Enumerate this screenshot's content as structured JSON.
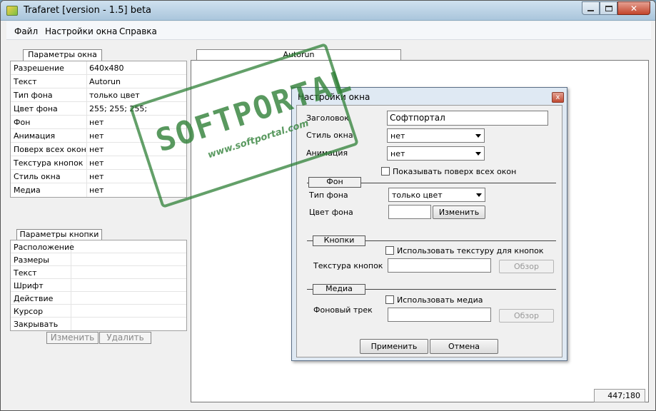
{
  "app": {
    "title": "Trafaret [version - 1.5] beta"
  },
  "menu": [
    "Файл",
    "Настройки окна",
    "Справка"
  ],
  "window_params": {
    "tab_label": "Параметры окна",
    "rows": [
      {
        "key": "Разрешение",
        "value": "640x480"
      },
      {
        "key": "Текст",
        "value": "Autorun"
      },
      {
        "key": "Тип фона",
        "value": "только цвет"
      },
      {
        "key": "Цвет фона",
        "value": "255; 255; 255;"
      },
      {
        "key": "Фон",
        "value": "нет"
      },
      {
        "key": "Анимация",
        "value": "нет"
      },
      {
        "key": "Поверх всех окон",
        "value": "нет"
      },
      {
        "key": "Текстура кнопок",
        "value": "нет"
      },
      {
        "key": "Стиль окна",
        "value": "нет"
      },
      {
        "key": "Медиа",
        "value": "нет"
      }
    ]
  },
  "button_params": {
    "tab_label": "Параметры кнопки",
    "rows": [
      "Расположение",
      "Размеры",
      "Текст",
      "Шрифт",
      "Действие",
      "Курсор",
      "Закрывать"
    ],
    "edit_label": "Изменить",
    "delete_label": "Удалить"
  },
  "canvas": {
    "tab_label": "Autorun",
    "coords": "447;180"
  },
  "dialog": {
    "title": "Настройки окна",
    "close_glyph": "x",
    "header_label": "Заголовок",
    "header_value": "Софтпортал",
    "window_style_label": "Стиль окна",
    "window_style_value": "нет",
    "animation_label": "Анимация",
    "animation_value": "нет",
    "topmost_label": "Показывать поверх всех окон",
    "bg_section": "Фон",
    "bg_type_label": "Тип фона",
    "bg_type_value": "только цвет",
    "bg_color_label": "Цвет фона",
    "change_label": "Изменить",
    "buttons_section": "Кнопки",
    "use_texture_label": "Использовать текстуру для кнопок",
    "texture_label": "Текстура кнопок",
    "browse_label": "Обзор",
    "media_section": "Медиа",
    "use_media_label": "Использовать медиа",
    "track_label": "Фоновый трек",
    "apply_label": "Применить",
    "cancel_label": "Отмена"
  },
  "watermark": {
    "big": "SOFTPORTAL",
    "small": "www.softportal.com"
  },
  "colors": {
    "title_bar": "#b9d1e6",
    "close_red": "#c3452c",
    "stamp_green": "#2f8037"
  }
}
